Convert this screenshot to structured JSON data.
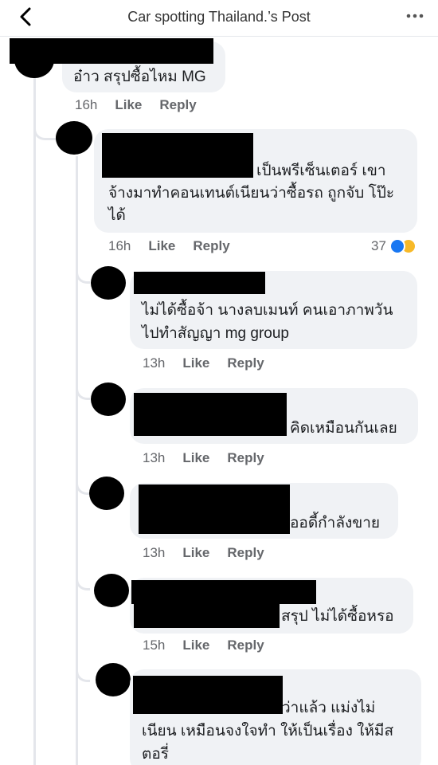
{
  "header": {
    "title": "Car spotting Thailand.’s Post"
  },
  "comments": [
    {
      "text_lines": [
        "อ๋าว สรุปซื้อไหม MG"
      ],
      "time": "16h",
      "like_label": "Like",
      "reply_label": "Reply"
    },
    {
      "text_lines": [
        "เป็นพรีเซ็นเตอร์ เขา",
        "จ้างมาทำคอนเทนต์เนียนว่าซื้อรถ ถูกจับ โป๊ะ",
        "ได้"
      ],
      "time": "16h",
      "like_label": "Like",
      "reply_label": "Reply",
      "reaction_count": "37",
      "reaction_icons": [
        "like-reaction-icon",
        "haha-reaction-icon"
      ]
    },
    {
      "text_lines": [
        "ไม่ได้ซื้อจ้า นางลบเมนท์ คนเอาภาพวัน",
        "ไปทำสัญญา mg group"
      ],
      "time": "13h",
      "like_label": "Like",
      "reply_label": "Reply"
    },
    {
      "text_lines": [
        "คิดเหมือนกันเลย"
      ],
      "time": "13h",
      "like_label": "Like",
      "reply_label": "Reply"
    },
    {
      "text_lines": [
        "ออดี้กำลังขาย"
      ],
      "time": "13h",
      "like_label": "Like",
      "reply_label": "Reply"
    },
    {
      "text_lines": [
        "สรุป ไม่ได้ซื้อหรอ"
      ],
      "time": "15h",
      "like_label": "Like",
      "reply_label": "Reply"
    },
    {
      "text_lines": [
        "ว่าแล้ว แม่งไม่",
        "เนียน เหมือนจงใจทำ ให้เป็นเรื่อง ให้มีส",
        "ตอรี่"
      ]
    }
  ],
  "colors": {
    "bubble": "#f0f2f5",
    "meta_text": "#65676b",
    "like_reaction": "#1877f2",
    "haha_reaction": "#f7b928"
  }
}
